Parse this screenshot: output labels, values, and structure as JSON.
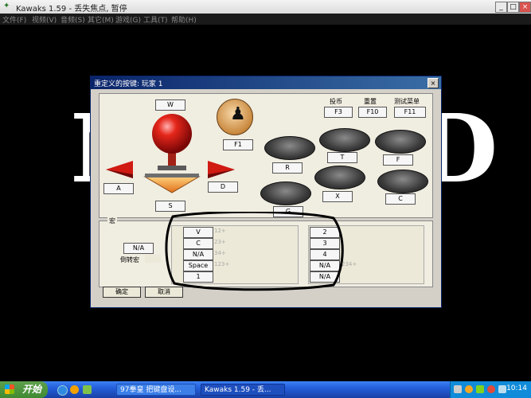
{
  "window": {
    "title": "Kawaks 1.59 - 丢失焦点, 暂停",
    "controls": [
      "_",
      "□",
      "×"
    ]
  },
  "menu": [
    "文件(F)",
    "视频(V)",
    "音频(S)",
    "其它(M)",
    "游戏(G)",
    "工具(T)",
    "帮助(H)"
  ],
  "background_logo": [
    "N",
    "D"
  ],
  "dialog": {
    "title": "重定义的按键: 玩家 1",
    "close": "×",
    "keys": {
      "up": "W",
      "left": "A",
      "right": "D",
      "down": "S",
      "start": "F1",
      "coin_label": "投币",
      "coin": "F3",
      "reset_label": "重置",
      "reset": "F10",
      "test_label": "测试菜单",
      "test": "F11",
      "btn_r": "R",
      "btn_t": "T",
      "btn_f": "F",
      "btn_g": "G",
      "btn_x": "X",
      "btn_c": "C"
    },
    "macro": {
      "label": "宏",
      "na": "N/A",
      "reverse_label": "倒转宏",
      "left_keys": [
        "V",
        "C",
        "N/A",
        "Space",
        "1"
      ],
      "left_hints": [
        "12+",
        "23+",
        "34+",
        "123+"
      ],
      "right_keys": [
        "2",
        "3",
        "4",
        "N/A",
        "N/A"
      ],
      "right_hint": "234+"
    },
    "ok": "确定",
    "cancel": "取消"
  },
  "taskbar": {
    "start": "开始",
    "tasks": [
      "97拳皇 把键盘设...",
      "Kawaks 1.59 - 丢..."
    ],
    "clock": "10:14"
  }
}
